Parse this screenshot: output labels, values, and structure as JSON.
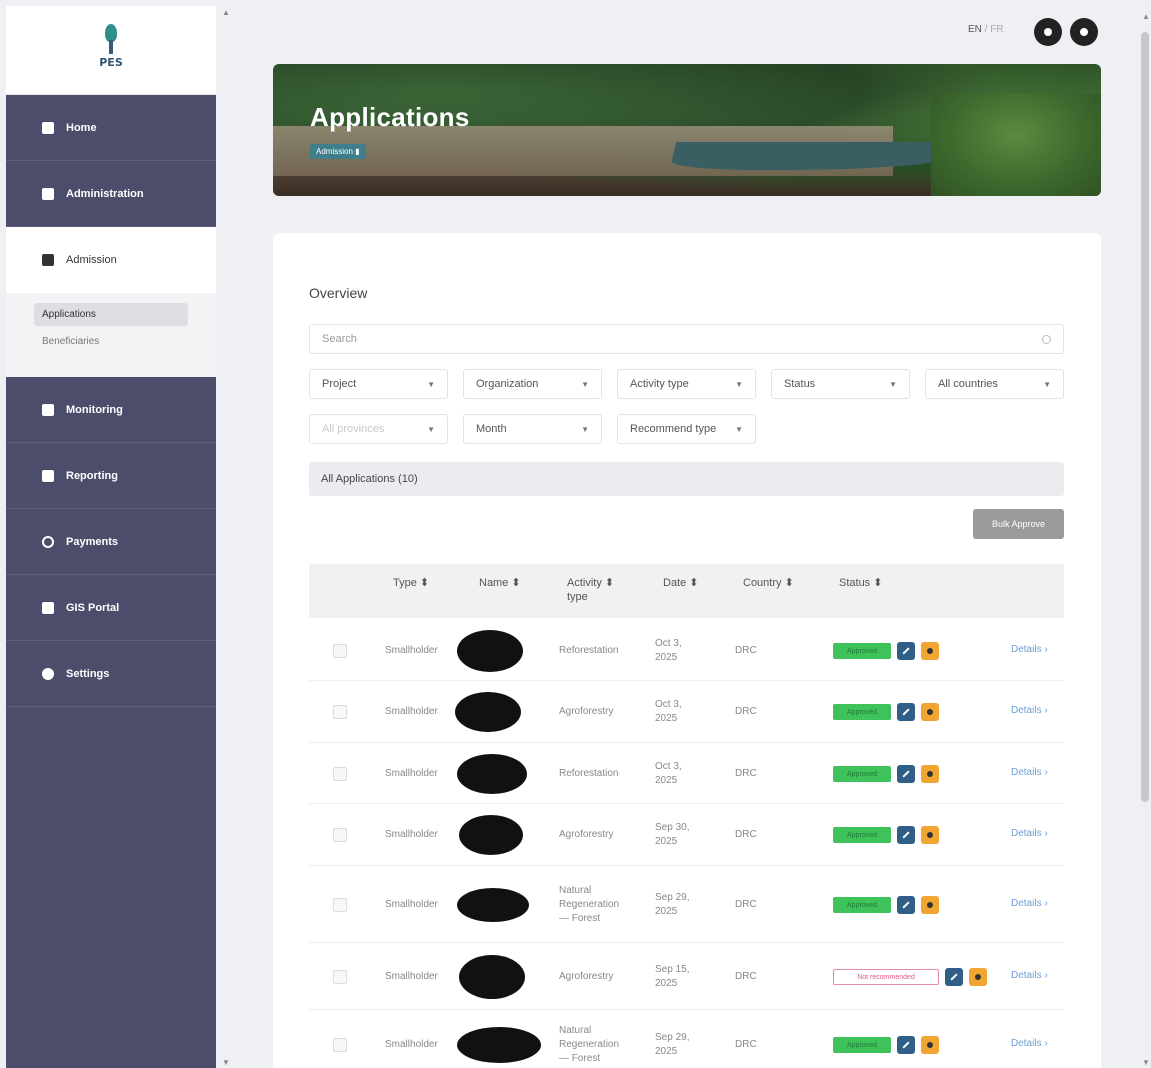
{
  "logo": {
    "text": "PES"
  },
  "sidebar": {
    "items": [
      {
        "label": "Home",
        "icon": "home-icon"
      },
      {
        "label": "Administration",
        "icon": "admin-icon"
      },
      {
        "label": "Admission",
        "icon": "admission-icon",
        "active": true
      },
      {
        "label": "Monitoring",
        "icon": "monitoring-icon"
      },
      {
        "label": "Reporting",
        "icon": "reporting-icon"
      },
      {
        "label": "Payments",
        "icon": "payments-icon"
      },
      {
        "label": "GIS Portal",
        "icon": "gis-icon"
      },
      {
        "label": "Settings",
        "icon": "gear-icon"
      }
    ],
    "subitems": [
      {
        "label": "Applications",
        "active": true
      },
      {
        "label": "Beneficiaries"
      }
    ]
  },
  "topbar": {
    "lang_en": "EN",
    "lang_sep": " / ",
    "lang_fr": "FR"
  },
  "banner": {
    "title": "Applications",
    "breadcrumb": "Admission ▮"
  },
  "overview": {
    "title": "Overview",
    "search_placeholder": "Search",
    "filters": {
      "project": "Project",
      "organization": "Organization",
      "activity_type": "Activity type",
      "status": "Status",
      "countries": "All countries",
      "provinces": "All provinces",
      "month": "Month",
      "recommend_type": "Recommend type"
    },
    "tab_label": "All Applications (10)",
    "bulk_approve": "Bulk Approve"
  },
  "table": {
    "headers": {
      "type": "Type ⬍",
      "name": "Name ⬍",
      "activity_1": "Activity ⬍",
      "activity_2": "type",
      "date": "Date ⬍",
      "country": "Country ⬍",
      "status": "Status ⬍"
    },
    "rows": [
      {
        "type": "Smallholder",
        "activity": [
          "Reforestation"
        ],
        "date": [
          "Oct 3,",
          "2025"
        ],
        "country": "DRC",
        "status": "Approved",
        "details": "Details ›"
      },
      {
        "type": "Smallholder",
        "activity": [
          "Agroforestry"
        ],
        "date": [
          "Oct 3,",
          "2025"
        ],
        "country": "DRC",
        "status": "Approved",
        "details": "Details ›"
      },
      {
        "type": "Smallholder",
        "activity": [
          "Reforestation"
        ],
        "date": [
          "Oct 3,",
          "2025"
        ],
        "country": "DRC",
        "status": "Approved",
        "details": "Details ›"
      },
      {
        "type": "Smallholder",
        "activity": [
          "Agroforestry"
        ],
        "date": [
          "Sep 30,",
          "2025"
        ],
        "country": "DRC",
        "status": "Approved",
        "details": "Details ›"
      },
      {
        "type": "Smallholder",
        "activity": [
          "Natural",
          "Regeneration",
          "— Forest"
        ],
        "date": [
          "Sep 29,",
          "2025"
        ],
        "country": "DRC",
        "status": "Approved",
        "details": "Details ›"
      },
      {
        "type": "Smallholder",
        "activity": [
          "Agroforestry"
        ],
        "date": [
          "Sep 15,",
          "2025"
        ],
        "country": "DRC",
        "status": "Not recommended",
        "details": "Details ›"
      },
      {
        "type": "Smallholder",
        "activity": [
          "Natural",
          "Regeneration",
          "— Forest"
        ],
        "date": [
          "Sep 29,",
          "2025"
        ],
        "country": "DRC",
        "status": "Approved",
        "details": "Details ›"
      }
    ]
  }
}
